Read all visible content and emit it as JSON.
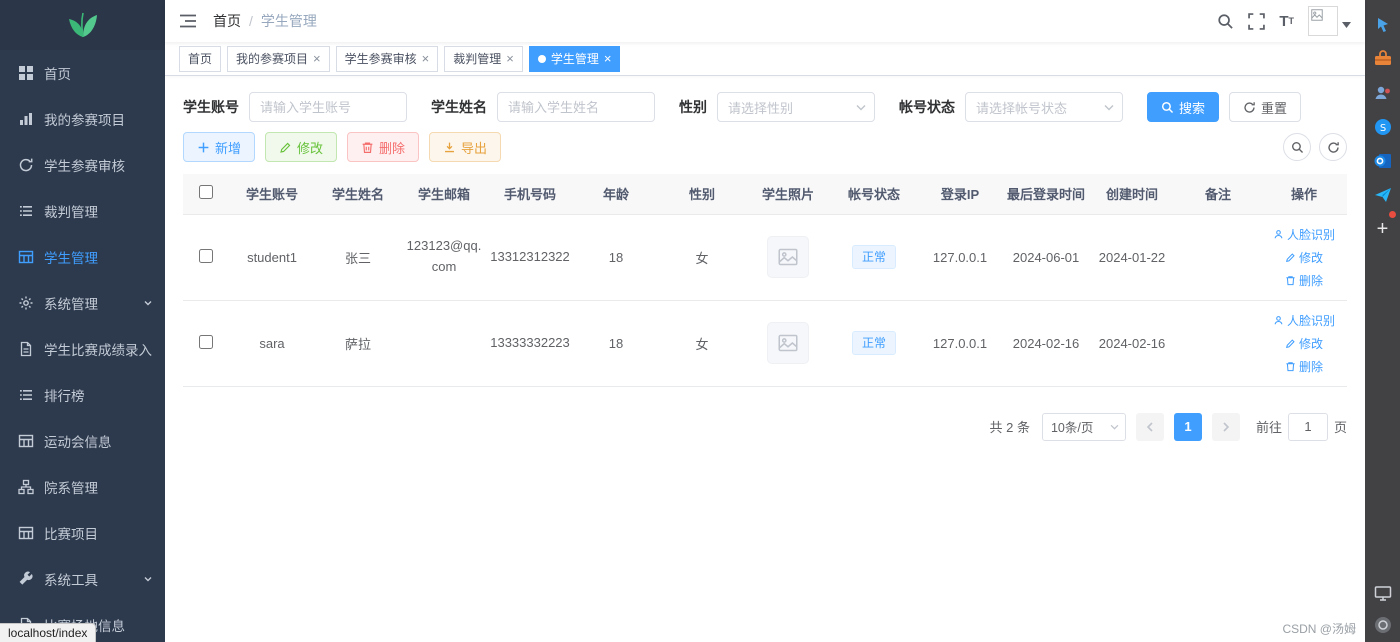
{
  "colors": {
    "primary": "#409eff",
    "sidebar_bg": "#2d3a4d",
    "success": "#67c23a",
    "danger": "#f56c6c",
    "warning": "#e6a23c",
    "logo_green": "#3bb878"
  },
  "navbar": {
    "breadcrumb": {
      "home": "首页",
      "separator": "/",
      "current": "学生管理"
    }
  },
  "icons": {
    "navbar": [
      "menu-fold-icon",
      "search-icon",
      "fullscreen-icon",
      "font-size-icon",
      "avatar-broken-image-icon",
      "caret-down-icon"
    ],
    "edge_sidebar": [
      "cursor-icon",
      "toolbox-icon",
      "contacts-icon",
      "skype-icon",
      "outlook-icon",
      "paper-plane-icon",
      "plus-icon",
      "monitor-icon",
      "workspace-icon"
    ]
  },
  "sidebar": {
    "items": [
      {
        "label": "首页",
        "icon": "dashboard-icon",
        "active": false
      },
      {
        "label": "我的参赛项目",
        "icon": "bar-chart-icon",
        "active": false
      },
      {
        "label": "学生参赛审核",
        "icon": "audit-refresh-icon",
        "active": false
      },
      {
        "label": "裁判管理",
        "icon": "list-icon",
        "active": false
      },
      {
        "label": "学生管理",
        "icon": "table-icon",
        "active": true
      },
      {
        "label": "系统管理",
        "icon": "gear-icon",
        "active": false,
        "expandable": true
      },
      {
        "label": "学生比赛成绩录入",
        "icon": "document-icon",
        "active": false
      },
      {
        "label": "排行榜",
        "icon": "list-icon",
        "active": false
      },
      {
        "label": "运动会信息",
        "icon": "table-icon",
        "active": false
      },
      {
        "label": "院系管理",
        "icon": "hierarchy-icon",
        "active": false
      },
      {
        "label": "比赛项目",
        "icon": "table-icon",
        "active": false
      },
      {
        "label": "系统工具",
        "icon": "wrench-icon",
        "active": false,
        "expandable": true
      },
      {
        "label": "比赛场地信息",
        "icon": "document-icon",
        "active": false
      }
    ]
  },
  "tabs": [
    {
      "label": "首页",
      "closable": false,
      "active": false
    },
    {
      "label": "我的参赛项目",
      "closable": true,
      "active": false
    },
    {
      "label": "学生参赛审核",
      "closable": true,
      "active": false
    },
    {
      "label": "裁判管理",
      "closable": true,
      "active": false
    },
    {
      "label": "学生管理",
      "closable": true,
      "active": true
    }
  ],
  "close_glyph": "×",
  "filters": {
    "account": {
      "label": "学生账号",
      "placeholder": "请输入学生账号"
    },
    "name": {
      "label": "学生姓名",
      "placeholder": "请输入学生姓名"
    },
    "gender": {
      "label": "性别",
      "placeholder": "请选择性别"
    },
    "status": {
      "label": "帐号状态",
      "placeholder": "请选择帐号状态"
    },
    "search_label": "搜索",
    "reset_label": "重置"
  },
  "toolbar": {
    "add": "新增",
    "edit": "修改",
    "delete": "删除",
    "export": "导出"
  },
  "table": {
    "columns": [
      "学生账号",
      "学生姓名",
      "学生邮箱",
      "手机号码",
      "年龄",
      "性别",
      "学生照片",
      "帐号状态",
      "登录IP",
      "最后登录时间",
      "创建时间",
      "备注",
      "操作"
    ],
    "row_actions": {
      "face": "人脸识别",
      "edit": "修改",
      "delete": "删除"
    },
    "rows": [
      {
        "account": "student1",
        "name": "张三",
        "email": "123123@qq.com",
        "phone": "13312312322",
        "age": "18",
        "gender": "女",
        "status": "正常",
        "login_ip": "127.0.0.1",
        "last_login": "2024-06-01",
        "created": "2024-01-22",
        "remark": ""
      },
      {
        "account": "sara",
        "name": "萨拉",
        "email": "",
        "phone": "13333332223",
        "age": "18",
        "gender": "女",
        "status": "正常",
        "login_ip": "127.0.0.1",
        "last_login": "2024-02-16",
        "created": "2024-02-16",
        "remark": ""
      }
    ]
  },
  "pagination": {
    "total": "共 2 条",
    "page_size": "10条/页",
    "current_page": "1",
    "goto_label": "前往",
    "goto_value": "1",
    "page_label": "页"
  },
  "status_bar": {
    "text": "localhost/index"
  },
  "watermark": {
    "text": "CSDN @汤姆"
  }
}
